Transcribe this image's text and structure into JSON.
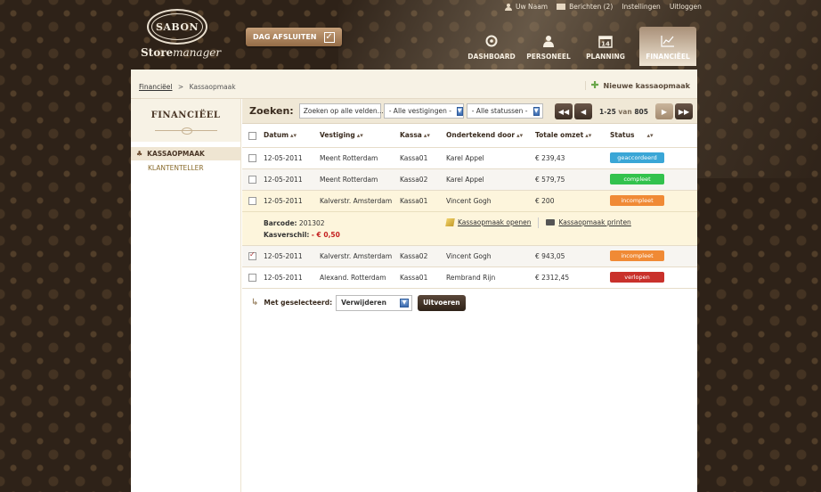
{
  "header": {
    "logo_text": "SABON",
    "brand_bold": "Store",
    "brand_italic": "manager",
    "close_day_label": "DAG AFSLUITEN",
    "top_links": {
      "user": "Uw Naam",
      "messages": "Berichten (2)",
      "settings": "Instellingen",
      "logout": "Uitloggen"
    },
    "nav": [
      {
        "label": "DASHBOARD",
        "icon": "target-icon"
      },
      {
        "label": "PERSONEEL",
        "icon": "person-icon"
      },
      {
        "label": "PLANNING",
        "icon": "calendar-icon",
        "icon_text": "14"
      },
      {
        "label": "FINANCIËEL",
        "icon": "chart-icon",
        "active": true
      }
    ]
  },
  "breadcrumb": {
    "root": "Financiëel",
    "sep": ">",
    "current": "Kassaopmaak"
  },
  "new_action": "Nieuwe kassaopmaak",
  "sidebar": {
    "title": "FINANCIËEL",
    "items": [
      {
        "label": "KASSAOPMAAK",
        "active": true
      },
      {
        "label": "KLANTENTELLER",
        "active": false
      }
    ]
  },
  "search": {
    "label": "Zoeken:",
    "input_value": "Zoeken op alle velden...",
    "branch_select": "- Alle vestigingen -",
    "status_select": "- Alle statussen -"
  },
  "pager": {
    "range": "1-25",
    "of_label": "van",
    "total": "805"
  },
  "table": {
    "headers": [
      "Datum",
      "Vestiging",
      "Kassa",
      "Ondertekend door",
      "Totale omzet",
      "Status"
    ],
    "rows": [
      {
        "date": "12-05-2011",
        "branch": "Meent Rotterdam",
        "register": "Kassa01",
        "signed": "Karel Appel",
        "total": "€ 239,43",
        "status": "geaccordeerd",
        "status_color": "#3aa6d6",
        "checked": false
      },
      {
        "date": "12-05-2011",
        "branch": "Meent Rotterdam",
        "register": "Kassa02",
        "signed": "Karel Appel",
        "total": "€ 579,75",
        "status": "compleet",
        "status_color": "#33c24d",
        "checked": false
      },
      {
        "date": "12-05-2011",
        "branch": "Kalverstr. Amsterdam",
        "register": "Kassa01",
        "signed": "Vincent Gogh",
        "total": "€ 200",
        "status": "incompleet",
        "status_color": "#f08a35",
        "checked": false
      },
      {
        "date": "12-05-2011",
        "branch": "Kalverstr. Amsterdam",
        "register": "Kassa02",
        "signed": "Vincent Gogh",
        "total": "€ 943,05",
        "status": "incompleet",
        "status_color": "#f08a35",
        "checked": true
      },
      {
        "date": "12-05-2011",
        "branch": "Alexand. Rotterdam",
        "register": "Kassa01",
        "signed": "Rembrand Rijn",
        "total": "€ 2312,45",
        "status": "verlopen",
        "status_color": "#c9312b",
        "checked": false
      }
    ],
    "detail": {
      "barcode_label": "Barcode:",
      "barcode_value": "201302",
      "diff_label": "Kasverschil:",
      "diff_value": "- € 0,50",
      "open_link": "Kassaopmaak openen",
      "print_link": "Kassaopmaak printen"
    }
  },
  "bulk": {
    "label": "Met geselecteerd:",
    "select_value": "Verwijderen",
    "execute": "Uitvoeren"
  }
}
